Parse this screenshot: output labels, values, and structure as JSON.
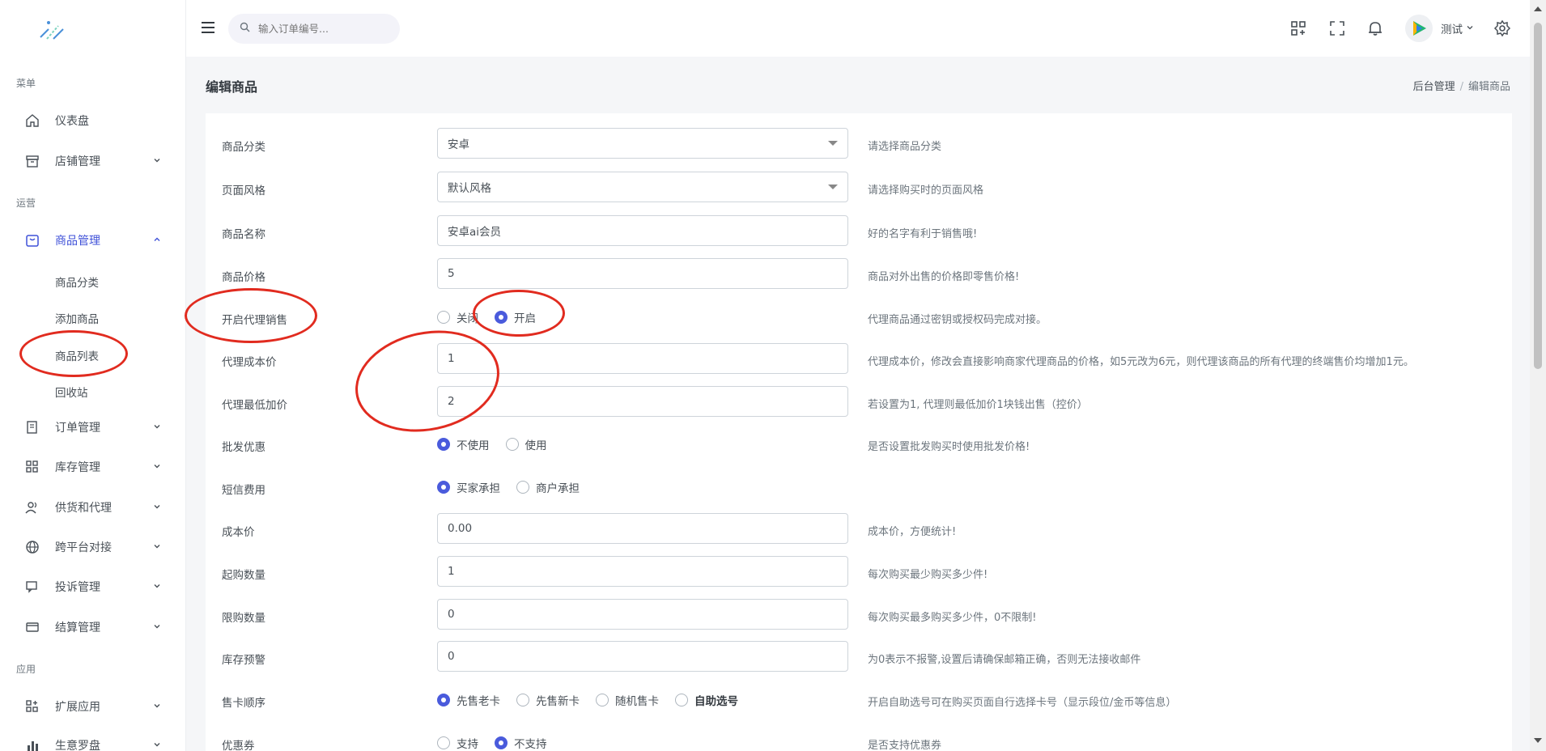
{
  "search": {
    "placeholder": "输入订单编号..."
  },
  "user": {
    "name": "测试"
  },
  "sidebar": {
    "sections": [
      "菜单",
      "运营",
      "应用"
    ],
    "items": [
      {
        "label": "仪表盘",
        "icon": "home-icon"
      },
      {
        "label": "店铺管理",
        "icon": "store-icon"
      },
      {
        "label": "商品管理",
        "icon": "bag-icon"
      },
      {
        "label": "订单管理",
        "icon": "receipt-icon"
      },
      {
        "label": "库存管理",
        "icon": "grid-icon"
      },
      {
        "label": "供货和代理",
        "icon": "users-icon"
      },
      {
        "label": "跨平台对接",
        "icon": "globe-icon"
      },
      {
        "label": "投诉管理",
        "icon": "message-icon"
      },
      {
        "label": "结算管理",
        "icon": "card-icon"
      },
      {
        "label": "扩展应用",
        "icon": "apps-icon"
      },
      {
        "label": "生意罗盘",
        "icon": "bar-chart-icon"
      }
    ],
    "subitems": [
      "商品分类",
      "添加商品",
      "商品列表",
      "回收站"
    ]
  },
  "page": {
    "title": "编辑商品",
    "breadcrumb": [
      "后台管理",
      "编辑商品"
    ]
  },
  "form": {
    "category": {
      "label": "商品分类",
      "value": "安卓",
      "help": "请选择商品分类"
    },
    "style": {
      "label": "页面风格",
      "value": "默认风格",
      "help": "请选择购买时的页面风格"
    },
    "name": {
      "label": "商品名称",
      "value": "安卓ai会员",
      "help": "好的名字有利于销售哦!"
    },
    "price": {
      "label": "商品价格",
      "value": "5",
      "help": "商品对外出售的价格即零售价格!"
    },
    "agent": {
      "label": "开启代理销售",
      "options": [
        "关闭",
        "开启"
      ],
      "selected": 1,
      "help": "代理商品通过密钥或授权码完成对接。"
    },
    "agent_cost": {
      "label": "代理成本价",
      "value": "1",
      "help": "代理成本价，修改会直接影响商家代理商品的价格，如5元改为6元，则代理该商品的所有代理的终端售价均增加1元。"
    },
    "agent_min_markup": {
      "label": "代理最低加价",
      "value": "2",
      "help": "若设置为1, 代理则最低加价1块钱出售（控价）"
    },
    "wholesale": {
      "label": "批发优惠",
      "options": [
        "不使用",
        "使用"
      ],
      "selected": 0,
      "help": "是否设置批发购买时使用批发价格!"
    },
    "sms_fee": {
      "label": "短信费用",
      "options": [
        "买家承担",
        "商户承担"
      ],
      "selected": 0,
      "help": ""
    },
    "cost": {
      "label": "成本价",
      "value": "0.00",
      "help": "成本价，方便统计!"
    },
    "min_qty": {
      "label": "起购数量",
      "value": "1",
      "help": "每次购买最少购买多少件!"
    },
    "max_qty": {
      "label": "限购数量",
      "value": "0",
      "help": "每次购买最多购买多少件，0不限制!"
    },
    "stock_alert": {
      "label": "库存预警",
      "value": "0",
      "help": "为0表示不报警,设置后请确保邮箱正确，否则无法接收邮件"
    },
    "sell_order": {
      "label": "售卡顺序",
      "options": [
        "先售老卡",
        "先售新卡",
        "随机售卡",
        "自助选号"
      ],
      "selected": 0,
      "help": "开启自助选号可在购买页面自行选择卡号（显示段位/金币等信息）"
    },
    "coupon": {
      "label": "优惠券",
      "options": [
        "支持",
        "不支持"
      ],
      "selected": 1,
      "help": "是否支持优惠券"
    }
  },
  "colors": {
    "accent": "#4a5bdc",
    "annotation": "#e12b1f"
  }
}
